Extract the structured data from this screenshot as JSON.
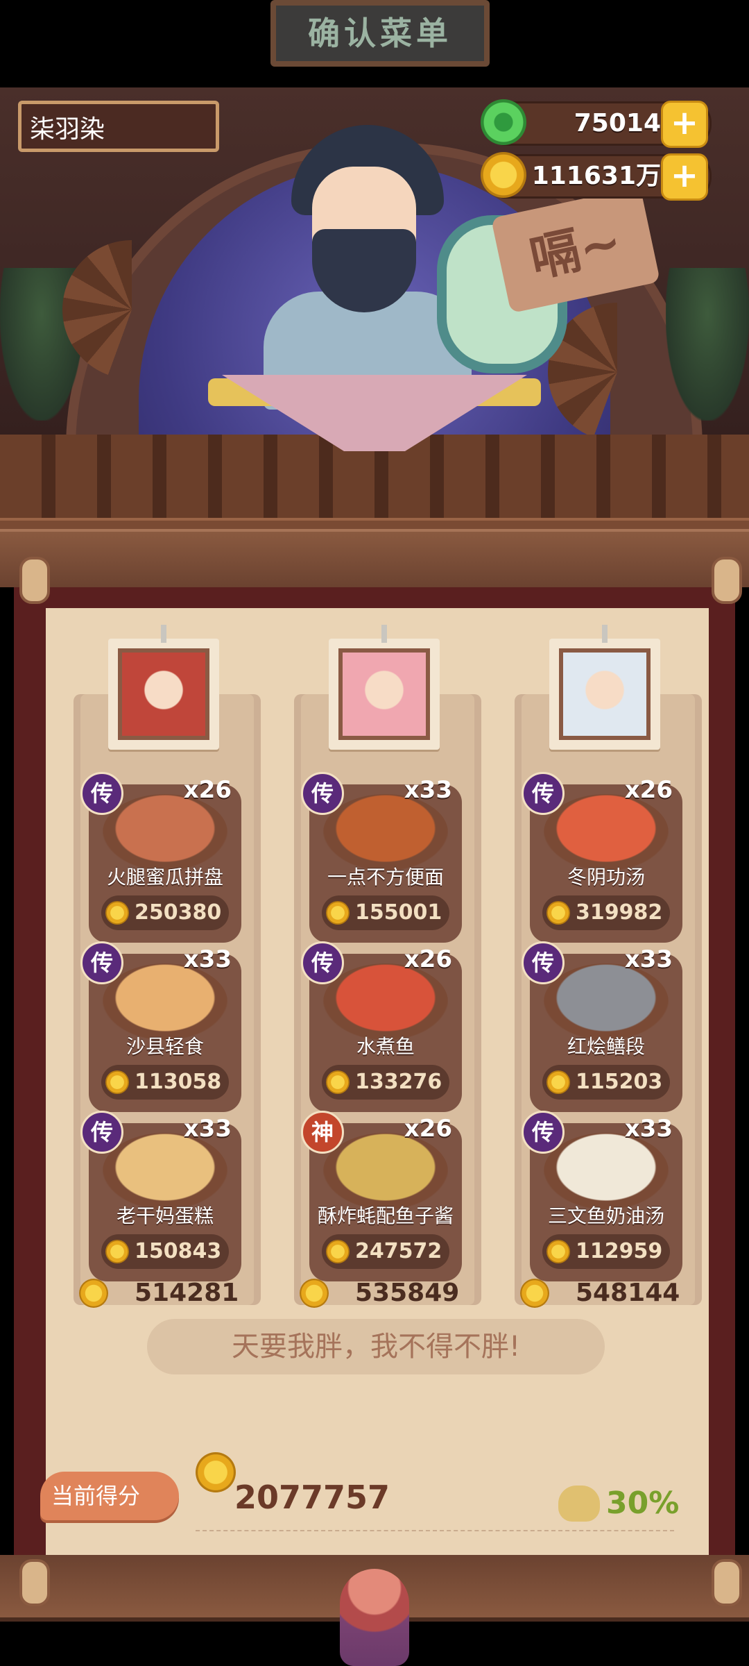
{
  "header": {
    "player_name": "柒羽染",
    "sign_text": "确认菜单",
    "jade": "75014",
    "gold": "111631万",
    "plus": "+"
  },
  "scene": {
    "speech": "嗝~"
  },
  "columns": [
    {
      "total": "514281",
      "dishes": [
        {
          "badge": "传",
          "badge_type": "chuan",
          "count": "x26",
          "name": "火腿蜜瓜拼盘",
          "price": "250380",
          "color": "#c9714f"
        },
        {
          "badge": "传",
          "badge_type": "chuan",
          "count": "x33",
          "name": "沙县轻食",
          "price": "113058",
          "color": "#e8b070"
        },
        {
          "badge": "传",
          "badge_type": "chuan",
          "count": "x33",
          "name": "老干妈蛋糕",
          "price": "150843",
          "color": "#e9c07e"
        }
      ]
    },
    {
      "total": "535849",
      "dishes": [
        {
          "badge": "传",
          "badge_type": "chuan",
          "count": "x33",
          "name": "一点不方便面",
          "price": "155001",
          "color": "#c06030"
        },
        {
          "badge": "传",
          "badge_type": "chuan",
          "count": "x26",
          "name": "水煮鱼",
          "price": "133276",
          "color": "#d8533a"
        },
        {
          "badge": "神",
          "badge_type": "shen",
          "count": "x26",
          "name": "酥炸蚝配鱼子酱",
          "price": "247572",
          "color": "#d7b25a"
        }
      ]
    },
    {
      "total": "548144",
      "dishes": [
        {
          "badge": "传",
          "badge_type": "chuan",
          "count": "x26",
          "name": "冬阴功汤",
          "price": "319982",
          "color": "#e06040"
        },
        {
          "badge": "传",
          "badge_type": "chuan",
          "count": "x33",
          "name": "红烩鳝段",
          "price": "115203",
          "color": "#8d8f95"
        },
        {
          "badge": "传",
          "badge_type": "chuan",
          "count": "x33",
          "name": "三文鱼奶油汤",
          "price": "112959",
          "color": "#f0e8d8"
        }
      ]
    }
  ],
  "motto": "天要我胖，我不得不胖!",
  "score": {
    "button_label": "当前得分",
    "value": "2077757",
    "bonus": "30%"
  },
  "icons": {
    "jade": "jade-disc-icon",
    "coin": "gold-coin-icon",
    "bonus": "fortune-pot-icon"
  }
}
